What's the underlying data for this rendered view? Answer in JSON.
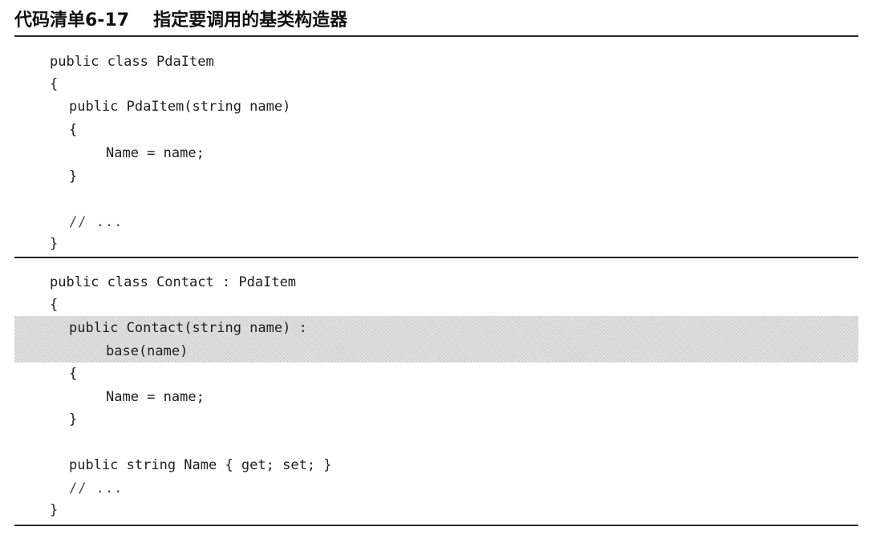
{
  "caption": {
    "number": "代码清单6-17",
    "title": "指定要调用的基类构造器"
  },
  "listing1": {
    "lines": [
      "public class PdaItem",
      "{",
      "public PdaItem(string name)",
      "{",
      "Name = name;",
      "}",
      "// ...",
      "}"
    ]
  },
  "listing2": {
    "lines": [
      "public class Contact : PdaItem",
      "{",
      "public Contact(string name) :",
      "base(name)",
      "{",
      "Name = name;",
      "}",
      "public string Name { get; set; }",
      "// ...",
      "}"
    ]
  },
  "colors": {
    "highlight": "#d9d9d9",
    "rule": "#2a2a2a",
    "text": "#1c1c1c"
  }
}
